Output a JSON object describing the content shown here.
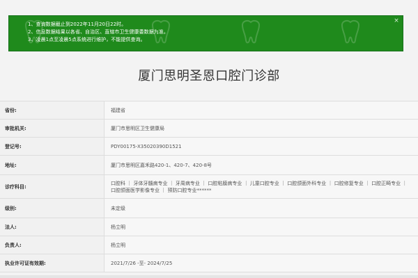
{
  "notice": {
    "items": [
      "1、查询数据截止到2022年11月20日22时。",
      "2、信息数据结果以各省、自治区、直辖市卫生健康委数据为准。",
      "3、凌晨1点至凌晨5点系统进行维护，不能提供查询。"
    ],
    "close_icon": "×",
    "watermark_icon": "tooth-icon",
    "accent": "#1f8a1c"
  },
  "page": {
    "title": "厦门思明圣恩口腔门诊部"
  },
  "table": {
    "rows": [
      {
        "label": "省份:",
        "value": "福建省"
      },
      {
        "label": "审批机关:",
        "value": "厦门市思明区卫生健康局"
      },
      {
        "label": "登记号:",
        "value": "PDY00175-X35020390D1521"
      },
      {
        "label": "地址:",
        "value": "厦门市思明区嘉禾路420-1、420-7、420-8号"
      },
      {
        "label": "诊疗科目:",
        "value": "口腔科 ｜ 牙体牙髓病专业 ｜ 牙周病专业 ｜ 口腔粘膜病专业 ｜ 儿童口腔专业 ｜ 口腔颌面外科专业 ｜ 口腔修复专业 ｜ 口腔正畸专业 ｜ 口腔颌面医学影像专业 ｜ 预防口腔专业******"
      },
      {
        "label": "级别:",
        "value": "未定级"
      },
      {
        "label": "法人:",
        "value": "杨立明"
      },
      {
        "label": "负责人:",
        "value": "杨立明"
      },
      {
        "label": "执业许可证有效期:",
        "value": "2021/7/26 -至- 2024/7/25"
      }
    ]
  }
}
